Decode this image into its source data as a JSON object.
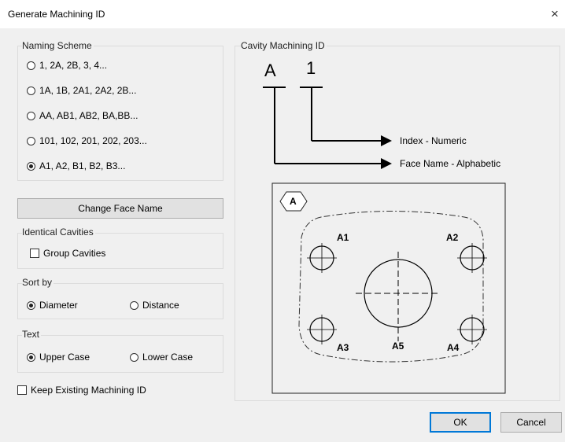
{
  "window": {
    "title": "Generate Machining ID",
    "close_glyph": "×"
  },
  "naming_scheme": {
    "label": "Naming Scheme",
    "options": [
      {
        "label": "1, 2A, 2B, 3, 4...",
        "selected": false
      },
      {
        "label": "1A, 1B, 2A1, 2A2, 2B...",
        "selected": false
      },
      {
        "label": "AA, AB1, AB2, BA,BB...",
        "selected": false
      },
      {
        "label": "101, 102, 201, 202, 203...",
        "selected": false
      },
      {
        "label": "A1, A2, B1, B2, B3...",
        "selected": true
      }
    ]
  },
  "change_face_name_label": "Change Face Name",
  "identical_cavities": {
    "label": "Identical Cavities",
    "group_cavities_label": "Group Cavities",
    "group_cavities_checked": false
  },
  "sort_by": {
    "label": "Sort by",
    "diameter_label": "Diameter",
    "distance_label": "Distance",
    "selected": "Diameter"
  },
  "text_case": {
    "label": "Text",
    "upper_label": "Upper Case",
    "lower_label": "Lower Case",
    "selected": "Upper Case"
  },
  "keep_existing": {
    "label": "Keep Existing Machining ID",
    "checked": false
  },
  "cavity_id": {
    "label": "Cavity Machining ID",
    "face_letter": "A",
    "index_digit": "1",
    "index_caption": "Index - Numeric",
    "face_caption": "Face Name - Alphabetic"
  },
  "preview": {
    "face_tag": "A",
    "hole_labels": [
      "A1",
      "A2",
      "A3",
      "A4",
      "A5"
    ]
  },
  "buttons": {
    "ok": "OK",
    "cancel": "Cancel"
  }
}
